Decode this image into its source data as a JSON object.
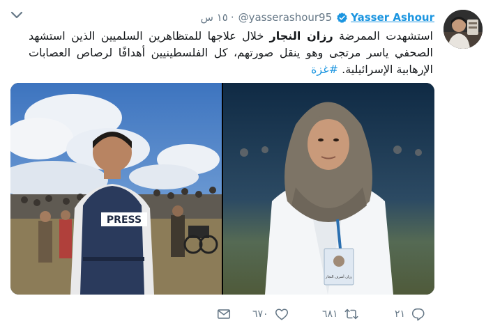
{
  "tweet": {
    "author": {
      "display_name": "Yasser Ashour",
      "handle": "@yasserashour95",
      "separator": "·",
      "time": "١٥ س"
    },
    "text": {
      "p1": "استشهدت الممرضة ",
      "bold": "رزان النجار",
      "p2": " خلال علاجها للمتظاهرين السلميين الذين استشهد الصحفي ياسر مرتجى وهو ينقل صورتهم، كل الفلسطينيين أهدافًا لرصاص العصابات الإرهابية الإسرائيلية. ",
      "hashtag": "#غزة"
    },
    "media": {
      "left_photo": {
        "vest_text": "PRESS",
        "colors": {
          "sky": "#4f86c9",
          "cloud": "#f2f4f7",
          "vest": "#2a3a5c",
          "ground": "#8a7a52"
        }
      },
      "right_photo": {
        "badge_text": "رزان أشرف النجار",
        "colors": {
          "background": "#1f3a55",
          "hijab": "#7d7466",
          "coat": "#f4f6f8",
          "skin": "#c99a7a"
        }
      }
    },
    "actions": {
      "reply_count": "٢١",
      "retweet_count": "٦٨١",
      "like_count": "٦٧٠",
      "icons": [
        "reply-icon",
        "retweet-icon",
        "like-icon",
        "message-icon"
      ]
    },
    "colors": {
      "accent": "#1b95e0",
      "muted": "#657786",
      "text": "#14171a"
    }
  }
}
